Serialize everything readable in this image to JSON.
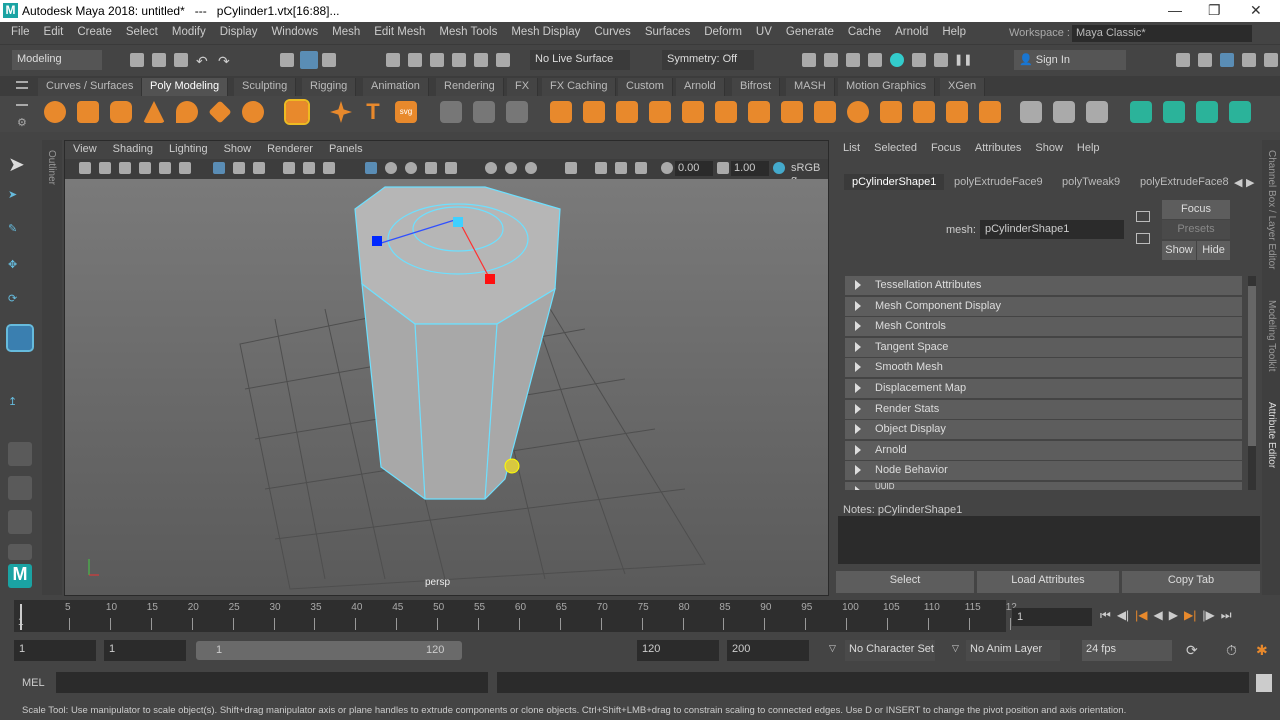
{
  "title": "Autodesk Maya 2018: untitled*   ---   pCylinder1.vtx[16:88]...",
  "menu": [
    "File",
    "Edit",
    "Create",
    "Select",
    "Modify",
    "Display",
    "Windows",
    "Mesh",
    "Edit Mesh",
    "Mesh Tools",
    "Mesh Display",
    "Curves",
    "Surfaces",
    "Deform",
    "UV",
    "Generate",
    "Cache",
    "Arnold",
    "Help"
  ],
  "workspace": {
    "label": "Workspace :",
    "value": "Maya Classic*"
  },
  "toolbar": {
    "menuset": "Modeling",
    "live_surface": "No Live Surface",
    "symmetry": "Symmetry: Off",
    "sign_in": "Sign In"
  },
  "shelf_tabs": [
    "Curves / Surfaces",
    "Poly Modeling",
    "Sculpting",
    "Rigging",
    "Animation",
    "Rendering",
    "FX",
    "FX Caching",
    "Custom",
    "Arnold",
    "Bifrost",
    "MASH",
    "Motion Graphics",
    "XGen"
  ],
  "shelf_active": "Poly Modeling",
  "viewport": {
    "menu": [
      "View",
      "Shading",
      "Lighting",
      "Show",
      "Renderer",
      "Panels"
    ],
    "exposure": "0.00",
    "gamma": "1.00",
    "colorspace": "sRGB g",
    "camera": "persp"
  },
  "outliner_label": "Outliner",
  "channel_box": {
    "menu": [
      "List",
      "Selected",
      "Focus",
      "Attributes",
      "Show",
      "Help"
    ],
    "tabs": [
      "pCylinderShape1",
      "polyExtrudeFace9",
      "polyTweak9",
      "polyExtrudeFace8"
    ],
    "mesh_label": "mesh:",
    "mesh_value": "pCylinderShape1",
    "focus": "Focus",
    "presets": "Presets",
    "show": "Show",
    "hide": "Hide",
    "sections": [
      "Tessellation Attributes",
      "Mesh Component Display",
      "Mesh Controls",
      "Tangent Space",
      "Smooth Mesh",
      "Displacement Map",
      "Render Stats",
      "Object Display",
      "Arnold",
      "Node Behavior",
      "UUID"
    ],
    "notes_label": "Notes:  pCylinderShape1",
    "buttons": [
      "Select",
      "Load Attributes",
      "Copy Tab"
    ]
  },
  "right_tabs": [
    "Channel Box / Layer Editor",
    "Modeling Toolkit",
    "Attribute Editor"
  ],
  "timeline": {
    "ticks": [
      "5",
      "10",
      "15",
      "20",
      "25",
      "30",
      "35",
      "40",
      "45",
      "50",
      "55",
      "60",
      "65",
      "70",
      "75",
      "80",
      "85",
      "90",
      "95",
      "100",
      "105",
      "110",
      "115",
      "12"
    ],
    "start": "1",
    "current": "1"
  },
  "range": {
    "start": "1",
    "inner_start": "1",
    "slider_start": "1",
    "slider_end": "120",
    "end": "120",
    "outer_end": "200",
    "character_set": "No Character Set",
    "anim_layer": "No Anim Layer",
    "fps": "24 fps"
  },
  "cmdline": {
    "label": "MEL"
  },
  "help": "Scale Tool: Use manipulator to scale object(s). Shift+drag manipulator axis or plane handles to extrude components or clone objects. Ctrl+Shift+LMB+drag to constrain scaling to connected edges. Use D or INSERT to change the pivot position and axis orientation."
}
